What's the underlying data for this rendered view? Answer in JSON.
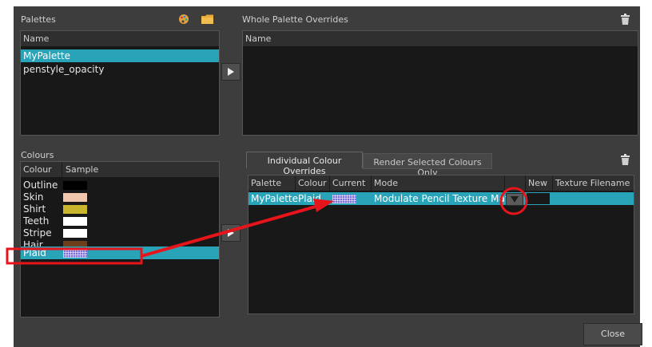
{
  "palettes": {
    "title": "Palettes",
    "col_name": "Name",
    "items": [
      {
        "label": "MyPalette",
        "selected": true
      },
      {
        "label": "penstyle_opacity",
        "selected": false
      }
    ],
    "icons": [
      "palette-icon",
      "folder-icon"
    ]
  },
  "whole_overrides": {
    "title": "Whole Palette Overrides",
    "col_name": "Name",
    "icon": "trash-icon"
  },
  "colours": {
    "title": "Colours",
    "col_colour": "Colour",
    "col_sample": "Sample",
    "items": [
      {
        "label": "Outline",
        "color": "#000000"
      },
      {
        "label": "Skin",
        "color": "#f1c8ae"
      },
      {
        "label": "Shirt",
        "color": "#c9b62d"
      },
      {
        "label": "Teeth",
        "color": "#ffffff"
      },
      {
        "label": "Stripe",
        "color": "#ffffff"
      },
      {
        "label": "Hair",
        "color": "#6b3f1c"
      },
      {
        "label": "Plaid",
        "color": "plaid",
        "selected": true
      }
    ]
  },
  "overrides": {
    "tabs": [
      {
        "label": "Individual Colour Overrides",
        "active": true
      },
      {
        "label": "Render Selected Colours Only",
        "active": false
      }
    ],
    "columns": [
      "Palette",
      "Colour",
      "Current",
      "Mode",
      "New",
      "Texture Filename"
    ],
    "row": {
      "palette": "MyPalette",
      "colour": "Plaid",
      "mode": "Modulate Pencil Texture Matrix"
    },
    "icon": "trash-icon"
  },
  "footer": {
    "close_label": "Close"
  },
  "colors": {
    "selection": "#29a3b8",
    "annotation": "#e8141c"
  }
}
